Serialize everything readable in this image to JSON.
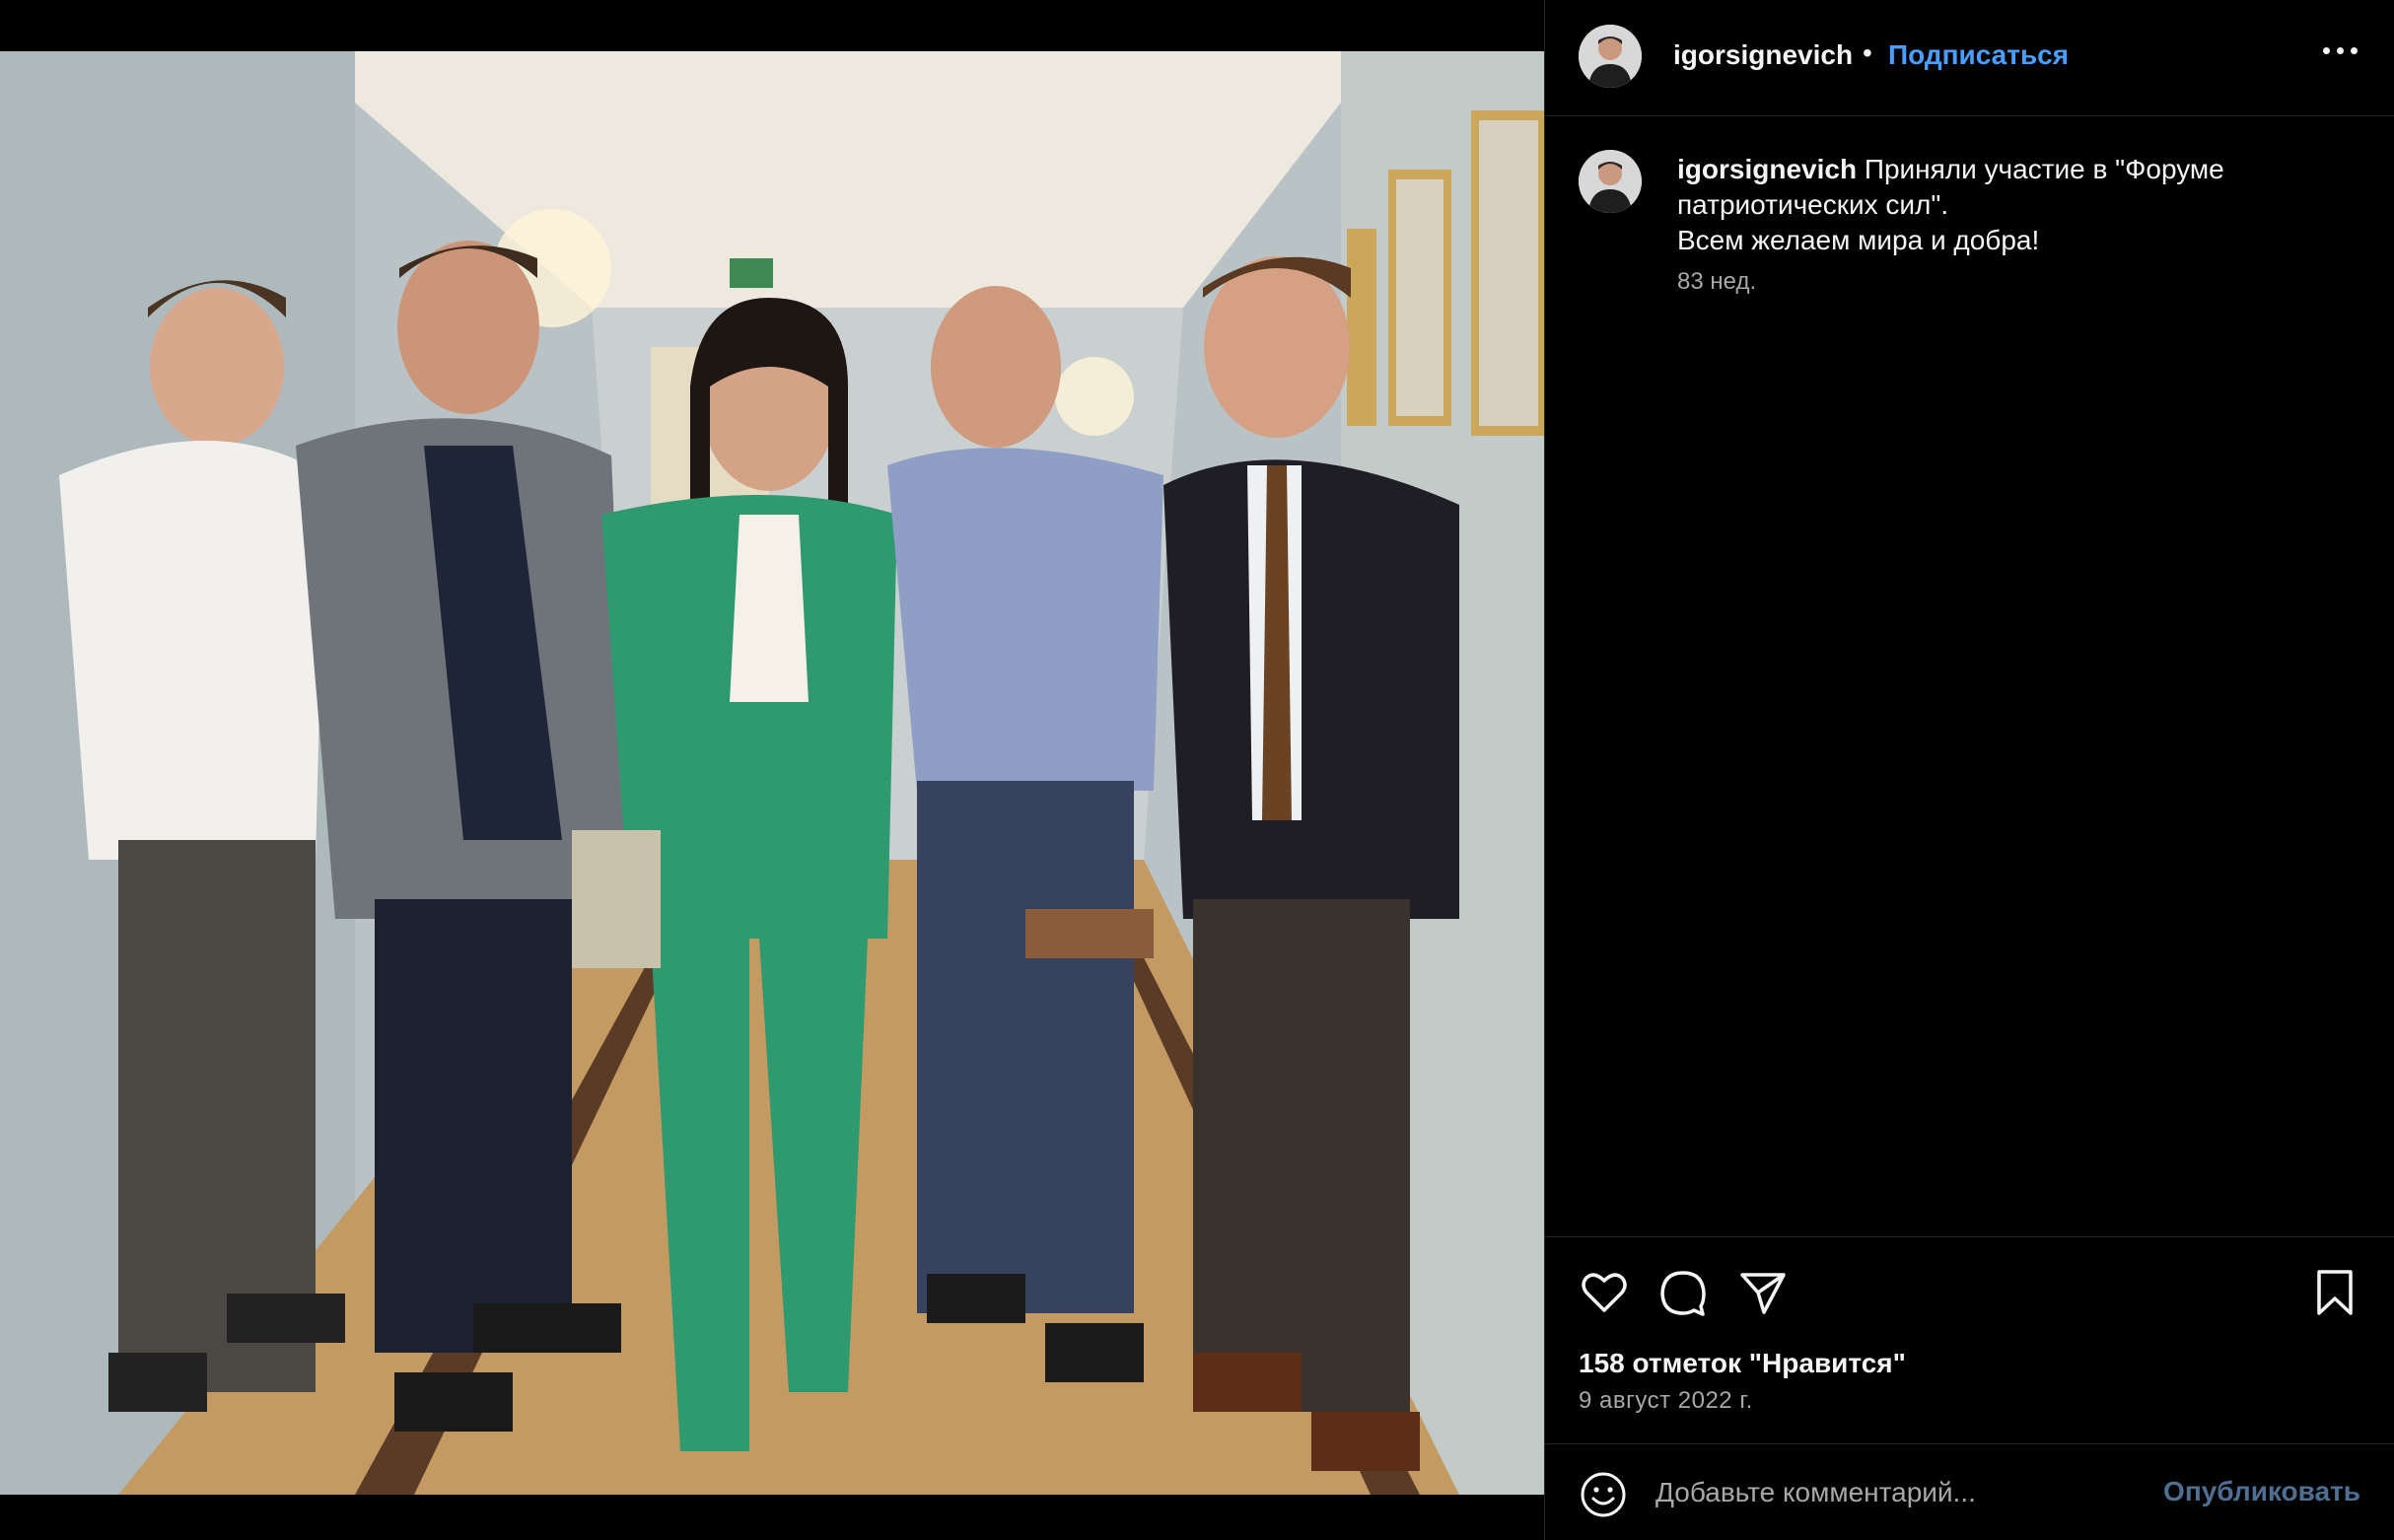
{
  "post": {
    "username": "igorsignevich",
    "dot": "•",
    "follow_label": "Подписаться",
    "caption_user": "igorsignevich",
    "caption_text": " Приняли участие в \"Форуме патриотических сил\".",
    "caption_line2": "Всем желаем мира и добра!",
    "time_ago": "83 нед.",
    "likes": "158 отметок \"Нравится\"",
    "date": "9 август 2022 г."
  },
  "comment": {
    "placeholder": "Добавьте комментарий...",
    "publish_label": "Опубликовать"
  },
  "icons": {
    "like": "heart-icon",
    "comment": "comment-icon",
    "share": "paper-plane-icon",
    "save": "bookmark-icon",
    "emoji": "smiley-icon",
    "more": "more-horizontal-icon"
  },
  "colors": {
    "background": "#000000",
    "link_blue": "#4a9eff",
    "muted_text": "#a8a8a8",
    "publish_disabled": "#4f6f92"
  }
}
